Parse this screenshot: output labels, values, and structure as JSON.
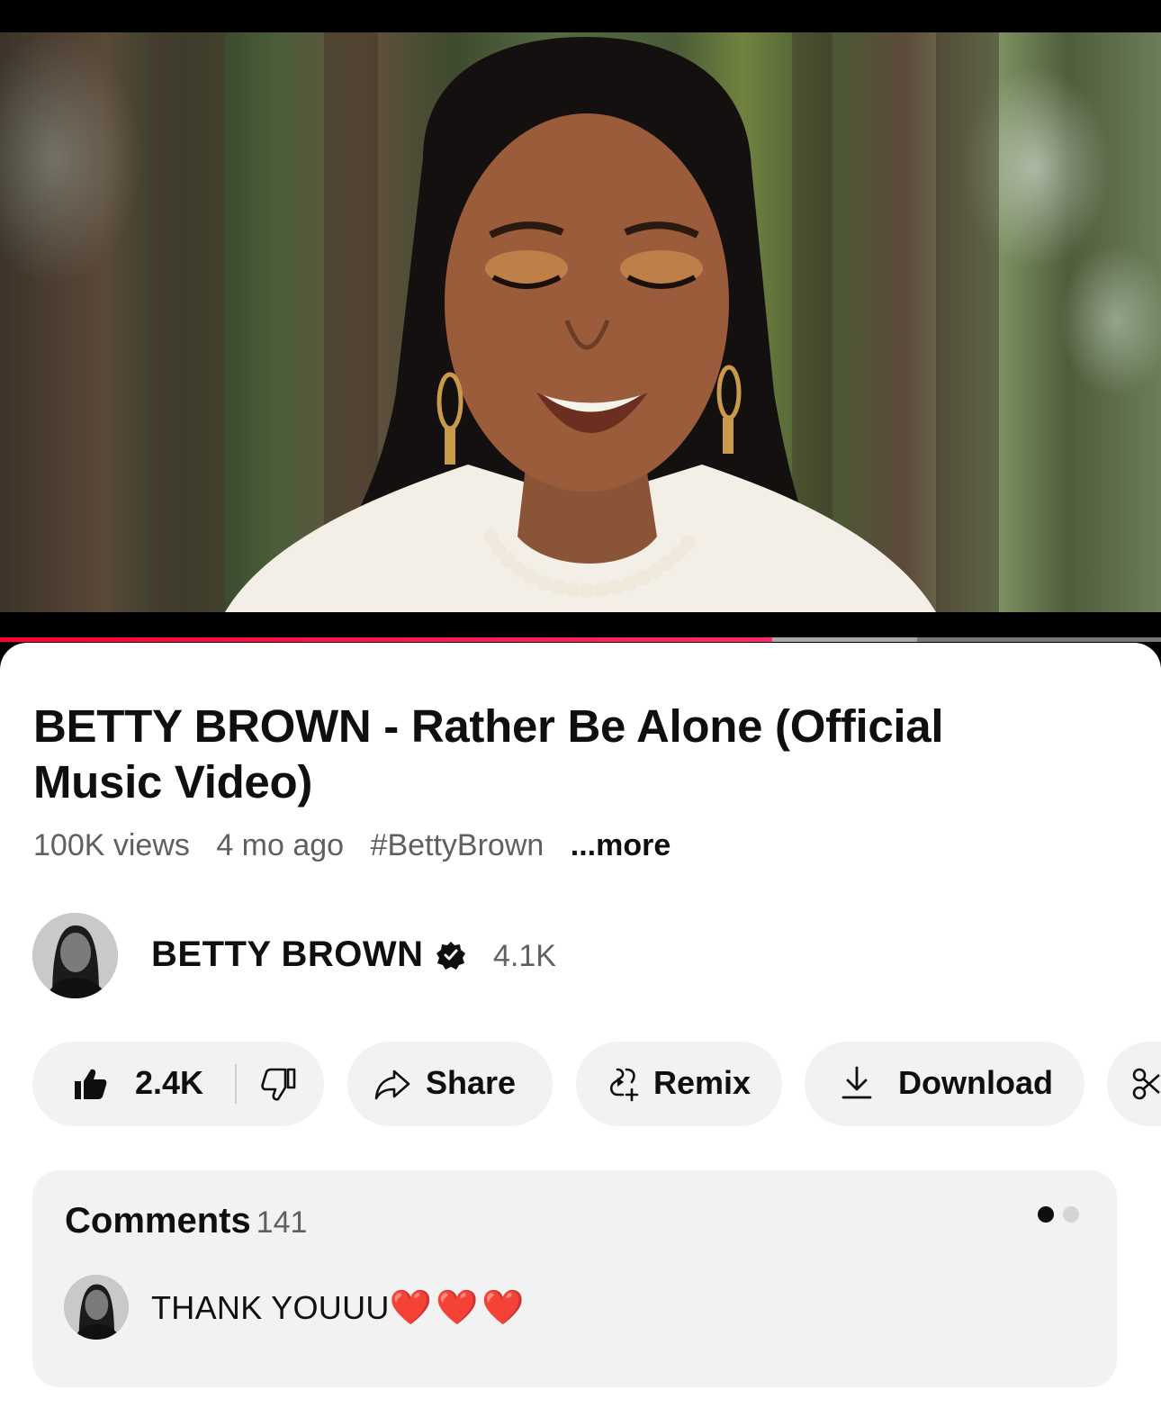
{
  "video": {
    "progress_played": 0.665,
    "progress_buffered": 0.79
  },
  "details": {
    "title": "BETTY BROWN - Rather Be Alone (Official Music Video)",
    "views": "100K views",
    "age": "4 mo ago",
    "hashtag": "#BettyBrown",
    "more_label": "...more"
  },
  "channel": {
    "name": "BETTY BROWN",
    "verified_icon": "verified-badge-icon",
    "subscribers": "4.1K"
  },
  "actions": {
    "like_count": "2.4K",
    "share_label": "Share",
    "remix_label": "Remix",
    "download_label": "Download",
    "icons": [
      "thumbs-up-icon",
      "thumbs-down-icon",
      "share-icon",
      "remix-icon",
      "download-icon",
      "clip-icon"
    ]
  },
  "comments": {
    "heading": "Comments",
    "count": "141",
    "top_comment": {
      "text": "THANK YOUUU",
      "emoji": "❤️❤️❤️"
    },
    "carousel_active": 1,
    "carousel_total": 2
  },
  "colors": {
    "accent_red": "#ff0033",
    "text_primary": "#0f0f0f",
    "text_secondary": "#606060",
    "pill_bg": "#f2f2f2",
    "heart": "#e0162b"
  }
}
